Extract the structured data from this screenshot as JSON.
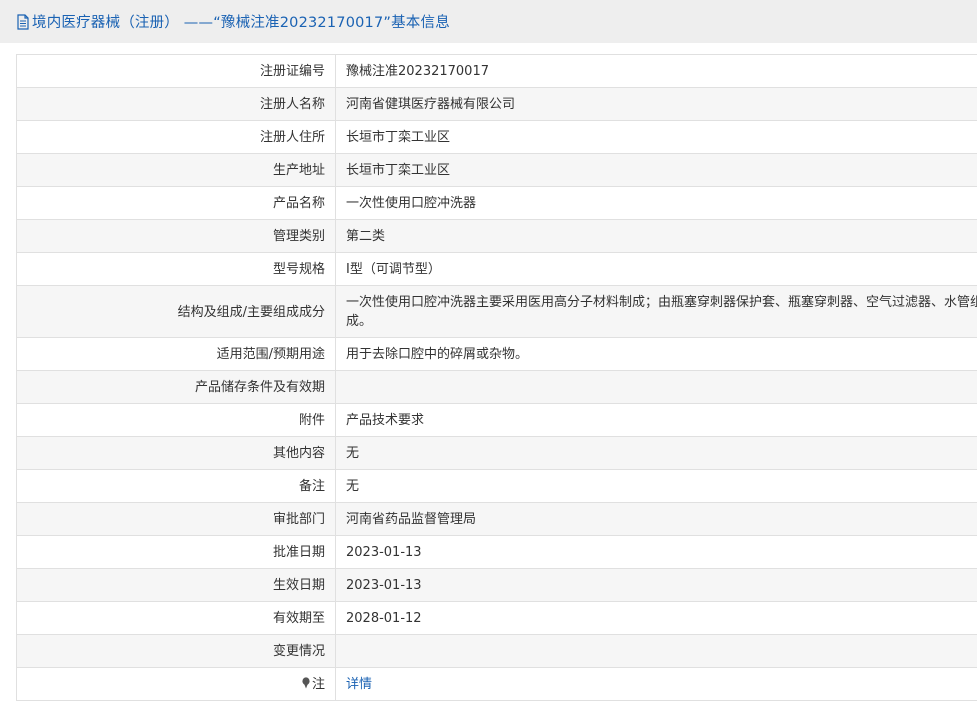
{
  "header": {
    "title": "境内医疗器械（注册） ——“豫械注准20232170017”基本信息",
    "icon": "document-icon"
  },
  "rows": [
    {
      "label": "注册证编号",
      "value": "豫械注准20232170017"
    },
    {
      "label": "注册人名称",
      "value": "河南省健琪医疗器械有限公司"
    },
    {
      "label": "注册人住所",
      "value": "长垣市丁栾工业区"
    },
    {
      "label": "生产地址",
      "value": "长垣市丁栾工业区"
    },
    {
      "label": "产品名称",
      "value": "一次性使用口腔冲洗器"
    },
    {
      "label": "管理类别",
      "value": "第二类"
    },
    {
      "label": "型号规格",
      "value": "Ⅰ型（可调节型）"
    },
    {
      "label": "结构及组成/主要组成成分",
      "value": "一次性使用口腔冲洗器主要采用医用高分子材料制成；由瓶塞穿刺器保护套、瓶塞穿刺器、空气过滤器、水管组成。"
    },
    {
      "label": "适用范围/预期用途",
      "value": "用于去除口腔中的碎屑或杂物。"
    },
    {
      "label": "产品储存条件及有效期",
      "value": ""
    },
    {
      "label": "附件",
      "value": "产品技术要求"
    },
    {
      "label": "其他内容",
      "value": "无"
    },
    {
      "label": "备注",
      "value": "无"
    },
    {
      "label": "审批部门",
      "value": "河南省药品监督管理局"
    },
    {
      "label": "批准日期",
      "value": "2023-01-13"
    },
    {
      "label": "生效日期",
      "value": "2023-01-13"
    },
    {
      "label": "有效期至",
      "value": "2028-01-12"
    },
    {
      "label": "变更情况",
      "value": ""
    }
  ],
  "note_row": {
    "label": "注",
    "icon": "pin-icon",
    "link_text": "详情"
  },
  "colors": {
    "accent": "#1a62b3",
    "header_bg": "#eeeeee",
    "row_alt_bg": "#f6f6f6",
    "border": "#e0e0e0"
  }
}
